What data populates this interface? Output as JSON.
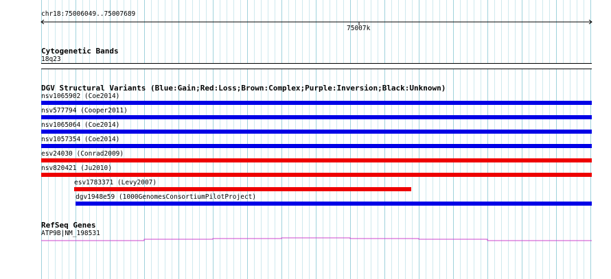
{
  "ruler": {
    "region_label": "chr18:75006049..75007689",
    "tick_label": "75007k"
  },
  "tracks": {
    "cytoband": {
      "title": "Cytogenetic Bands",
      "band_label": "18q23"
    },
    "dgv": {
      "title": "DGV Structural Variants (Blue:Gain;Red:Loss;Brown:Complex;Purple:Inversion;Black:Unknown)",
      "features": [
        {
          "label": "nsv1065902 (Coe2014)",
          "type": "Gain",
          "color": "#0000e6"
        },
        {
          "label": "nsv577794 (Cooper2011)",
          "type": "Gain",
          "color": "#0000e6"
        },
        {
          "label": "nsv1065064 (Coe2014)",
          "type": "Gain",
          "color": "#0000e6"
        },
        {
          "label": "nsv1057354 (Coe2014)",
          "type": "Gain",
          "color": "#0000e6"
        },
        {
          "label": "esv24030 (Conrad2009)",
          "type": "Loss",
          "color": "#ee0000"
        },
        {
          "label": "nsv820421 (Ju2010)",
          "type": "Loss",
          "color": "#ee0000"
        },
        {
          "label": "esv1783371 (Levy2007)",
          "type": "Loss",
          "color": "#ee0000"
        },
        {
          "label": "dgv1948e59 (1000GenomesConsortiumPilotProject)",
          "type": "Gain",
          "color": "#0000e6"
        }
      ]
    },
    "refseq": {
      "title": "RefSeq Genes",
      "gene_label": "ATP9B|NM_198531",
      "color": "#cc44cc"
    }
  }
}
